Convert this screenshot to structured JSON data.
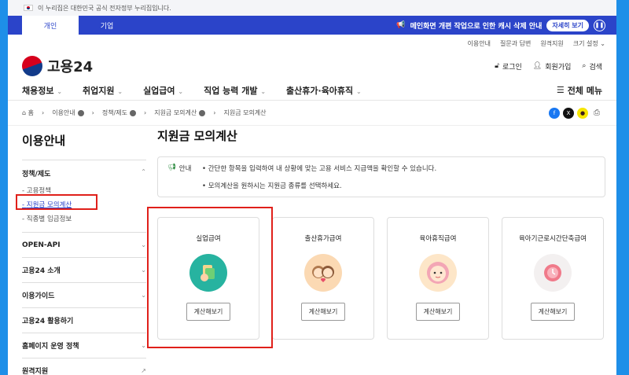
{
  "gov_banner": "이 누리집은 대한민국 공식 전자정부 누리집입니다.",
  "tabs": [
    "개인",
    "기업"
  ],
  "notice": {
    "text": "메인화면 개편 작업으로 인한 캐시 삭제 안내",
    "button": "자세히 보기"
  },
  "util_links": [
    "이용안내",
    "질문과 답변",
    "원격지원",
    "크기 설정 ⌄"
  ],
  "logo": "고용24",
  "auth": {
    "login": "로그인",
    "join": "회원가입",
    "search": "검색"
  },
  "gnb": [
    "채용정보",
    "취업지원",
    "실업급여",
    "직업 능력 개발",
    "출산휴가·육아휴직"
  ],
  "full_menu": "전체 메뉴",
  "breadcrumb": [
    "홈",
    "이용안내",
    "정책/제도",
    "지원금 모의계산",
    "지원금 모의계산"
  ],
  "sidebar": {
    "title": "이용안내",
    "group": "정책/제도",
    "subs": [
      "고용정책",
      "지원금 모의계산",
      "직종별 임금정보"
    ],
    "items": [
      "OPEN-API",
      "고용24 소개",
      "이용가이드",
      "고용24 활용하기",
      "홈페이지 운영 정책",
      "원격지원"
    ]
  },
  "main": {
    "title": "지원금 모의계산",
    "info_label": "안내",
    "info_lines": [
      "간단한 항목을 입력하여 내 상황에 맞는 고용 서비스 지급액을 확인할 수 있습니다.",
      "모의계산을 원하시는 지원금 종류를 선택하세요."
    ],
    "cards": [
      {
        "title": "실업급여",
        "button": "계산해보기"
      },
      {
        "title": "출산휴가급여",
        "button": "계산해보기"
      },
      {
        "title": "육아휴직급여",
        "button": "계산해보기"
      },
      {
        "title": "육아기근로시간단축급여",
        "button": "계산해보기"
      }
    ]
  },
  "colors": {
    "brand": "#2b44c9",
    "highlight": "#e0201a",
    "frame": "#1e8fe8"
  }
}
